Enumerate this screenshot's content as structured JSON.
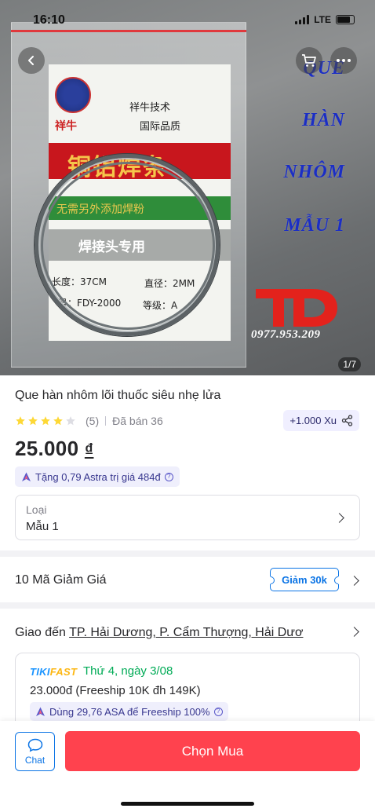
{
  "status_bar": {
    "time": "16:10",
    "network": "LTE"
  },
  "hero": {
    "promo_lines": [
      "QUE",
      "HÀN",
      "NHÔM",
      "MẪU 1"
    ],
    "phone": "0977.953.209",
    "logo_text": "TD",
    "counter": "1/7",
    "package_texts": {
      "brand": "祥牛",
      "tagline1": "祥牛技术",
      "tagline2": "国际品质",
      "big_title": "铜铝焊条",
      "green_text": "无需另外添加焊粉",
      "grey_text": "焊接头专用",
      "spec_length": "长度：37CM",
      "spec_diameter": "直径：2MM",
      "spec_model": "号：FDY-2000",
      "spec_grade": "等级：A"
    }
  },
  "product": {
    "title": "Que hàn nhôm lõi thuốc siêu nhẹ lửa",
    "rating": 4,
    "review_count": "(5)",
    "sold": "Đã bán 36",
    "xu_reward": "+1.000 Xu",
    "price": "25.000",
    "currency": "₫",
    "astra_gift": "Tặng 0,79 Astra trị giá 484đ"
  },
  "variant": {
    "label": "Loại",
    "value": "Mẫu 1"
  },
  "coupons": {
    "label": "10 Mã Giảm Giá",
    "tag": "Giảm 30k"
  },
  "shipping": {
    "prefix": "Giao đến ",
    "address": "TP. Hải Dương, P. Cẩm Thượng, Hải Dươ",
    "service_a": "TIKI",
    "service_b": "FAST",
    "date": "Thứ 4, ngày 3/08",
    "fee": "23.000đ (Freeship 10K đh 149K)",
    "asa_offer": "Dùng 29,76 ASA để Freeship 100%"
  },
  "actions": {
    "chat_label": "Chat",
    "buy_label": "Chọn Mua"
  },
  "colors": {
    "accent_blue": "#0b74e5",
    "buy_red": "#ff424e",
    "star": "#fdd836",
    "green": "#00ab56"
  },
  "icons": [
    "back-icon",
    "cart-icon",
    "more-icon",
    "star-icon",
    "share-icon",
    "astra-icon",
    "info-icon",
    "chevron-right-icon",
    "chat-icon"
  ]
}
